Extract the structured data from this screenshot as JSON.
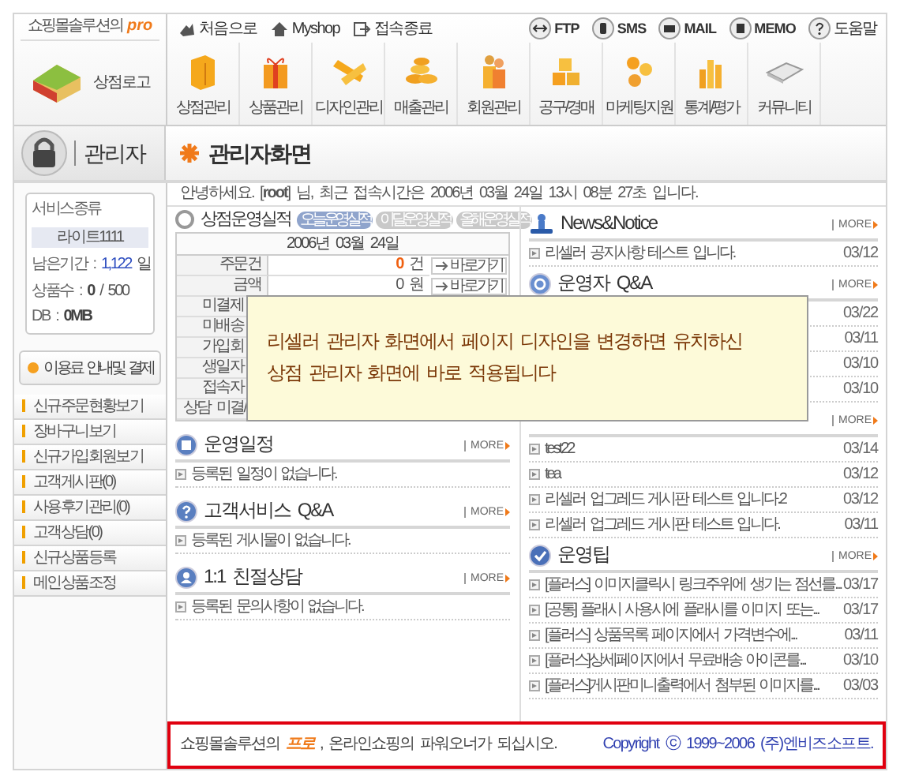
{
  "header": {
    "brand": "쇼핑몰솔루션의",
    "brand_badge": "pro",
    "logo_label": "상점로고",
    "top_links": [
      {
        "label": "처음으로"
      },
      {
        "label": "Myshop"
      },
      {
        "label": "접속종료"
      }
    ],
    "tools": [
      {
        "label": "FTP"
      },
      {
        "label": "SMS"
      },
      {
        "label": "MAIL"
      },
      {
        "label": "MEMO"
      },
      {
        "label": "도움말"
      }
    ],
    "nav": [
      {
        "label": "상점관리"
      },
      {
        "label": "상품관리"
      },
      {
        "label": "디자인관리"
      },
      {
        "label": "매출관리"
      },
      {
        "label": "회원관리"
      },
      {
        "label": "공구/경매"
      },
      {
        "label": "마케팅지원"
      },
      {
        "label": "통계/평가"
      },
      {
        "label": "커뮤니티"
      }
    ]
  },
  "admin": {
    "label": "관리자"
  },
  "page_title": "관리자화면",
  "greeting": "안녕하세요. [**root**] 님, 최근 접속시간은 2006년 03월 24일 13시 08분 27초 입니다.",
  "sidebar": {
    "service_label": "서비스종류",
    "service_value": "라이트1111",
    "stats": [
      {
        "kind": "link",
        "label": "남은기간 :",
        "value": "1,122",
        "unit": "일"
      },
      {
        "kind": "bold",
        "label": "상품수 :",
        "value": "0",
        "unit": "/ 500"
      },
      {
        "kind": "bold",
        "label": "DB :",
        "value": "0MB"
      }
    ],
    "pay_button": "이용료 안내및 결제",
    "menu": [
      "신규주문현황보기",
      "장바구니보기",
      "신규가입회원보기",
      "고객게시판(0)",
      "사용후기관리(0)",
      "고객상담(0)",
      "신규상품등록",
      "메인상품조정"
    ]
  },
  "performance": {
    "title": "상점운영실적",
    "tabs": [
      {
        "label": "오늘운영실적",
        "selected": true
      },
      {
        "label": "이달운영실적",
        "selected": false
      },
      {
        "label": "올해운영실적",
        "selected": false
      }
    ],
    "date": "2006년 03월 24일",
    "rows": [
      {
        "label": "주문건",
        "count": "0",
        "unit": "건",
        "highlight": true,
        "action": "바로가기"
      },
      {
        "label": "금액",
        "count": "0",
        "unit": "원",
        "highlight": false,
        "action": "바로가기"
      },
      {
        "label": "미결제"
      },
      {
        "label": "미배송"
      },
      {
        "label": "가입회"
      },
      {
        "label": "생일자"
      },
      {
        "label": "접속자"
      },
      {
        "label": "상담 미결/"
      }
    ]
  },
  "boards_left": [
    {
      "title": "운영일정",
      "more": "MORE",
      "items": [
        {
          "text": "등록된 일정이 없습니다."
        }
      ]
    },
    {
      "title": "고객서비스 Q&A",
      "more": "MORE",
      "items": [
        {
          "text": "등록된 게시물이 없습니다."
        }
      ]
    },
    {
      "title": "1:1 친절상담",
      "more": "MORE",
      "items": [
        {
          "text": "등록된 문의사항이 없습니다."
        }
      ]
    }
  ],
  "boards_right": [
    {
      "title": "News&Notice",
      "more": "MORE",
      "items": [
        {
          "text": "리셀러 공지사항 테스트 입니다.",
          "date": "03/12"
        }
      ]
    },
    {
      "title": "운영자 Q&A",
      "more": "MORE",
      "items": [
        {
          "date": "03/22"
        },
        {
          "date": "03/11"
        },
        {
          "date": "03/10"
        },
        {
          "date": "03/10"
        }
      ]
    },
    {
      "more": "MORE",
      "items": [
        {
          "text": "test22",
          "date": "03/14"
        },
        {
          "text": "tea",
          "date": "03/12"
        },
        {
          "text": "리셀러 업그레드 게시판 테스트 입니다.2",
          "date": "03/12"
        },
        {
          "text": "리셀러 업그레드 게시판 테스트 입니다.",
          "date": "03/11"
        }
      ]
    },
    {
      "title": "운영팁",
      "more": "MORE",
      "items": [
        {
          "text": "[플러스] 이미지클릭시 링크주위에 생기는 점선를...",
          "date": "03/17"
        },
        {
          "text": "[공통] 플래시 사용시에 플래시를 이미지 또는...",
          "date": "03/17"
        },
        {
          "text": "[플러스] 상품목록 페이지에서 가격변수에...",
          "date": "03/11"
        },
        {
          "text": "[플러스]상세페이지에서 무료배송 아이콘를...",
          "date": "03/10"
        },
        {
          "text": "[플러스]게시판미니출력에서 첨부된 이미지를...",
          "date": "03/03"
        }
      ]
    }
  ],
  "notice_overlay": {
    "lines": [
      "리셀러 관리자 화면에서 페이지 디자인을 변경하면 유치하신",
      "상점 관리자 화면에 바로 적용됩니다"
    ]
  },
  "footer": {
    "slogan": "쇼핑몰솔루션의 **프로** , 온라인쇼핑의 파워오너가 되십시오.",
    "copyright": "Copyright ⓒ 1999~2006 (주)엔비즈소프트."
  }
}
